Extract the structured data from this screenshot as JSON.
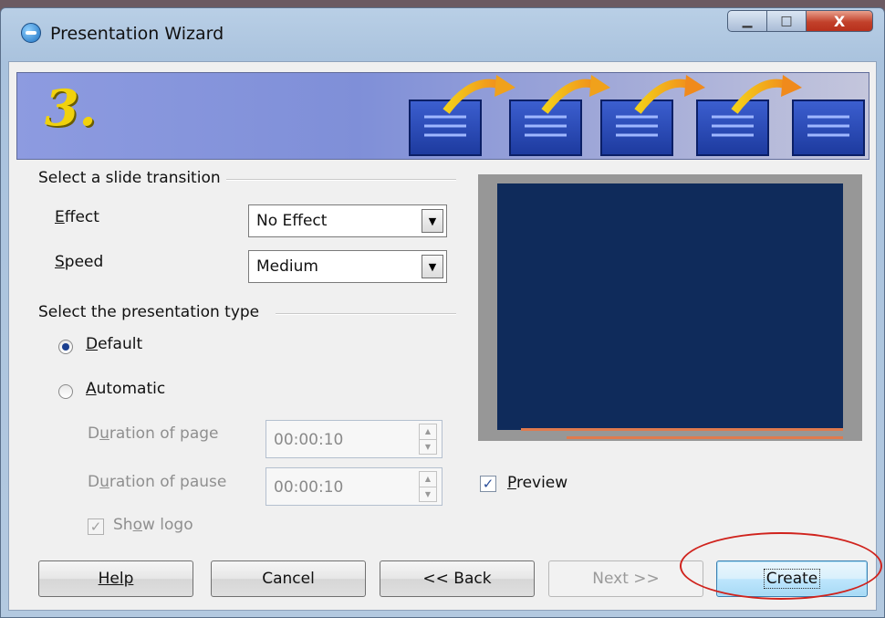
{
  "window": {
    "title": "Presentation Wizard",
    "controls": {
      "minimize": "▁",
      "maximize": "□",
      "close": "X"
    }
  },
  "banner": {
    "step": "3."
  },
  "transition": {
    "group_label": "Select a slide transition",
    "effect_label": "Effect",
    "effect_value": "No Effect",
    "speed_label": "Speed",
    "speed_value": "Medium"
  },
  "presentation_type": {
    "group_label": "Select the presentation type",
    "default_label": "Default",
    "automatic_label": "Automatic",
    "selected": "Default",
    "duration_page_label": "Duration of page",
    "duration_page_value": "00:00:10",
    "duration_pause_label": "Duration of pause",
    "duration_pause_value": "00:00:10",
    "show_logo_label": "Show logo",
    "show_logo_checked": true
  },
  "preview": {
    "label": "Preview",
    "checked": true
  },
  "buttons": {
    "help": "Help",
    "cancel": "Cancel",
    "back": "<< Back",
    "next": "Next >>",
    "create": "Create"
  },
  "colors": {
    "highlight_ellipse": "#d0231d",
    "slide_background": "#0f2b5b",
    "slide_lines": "#e07a4e",
    "step_number": "#f1d20d"
  },
  "icons": [
    "app-icon",
    "arrow-icon",
    "page-icon"
  ]
}
